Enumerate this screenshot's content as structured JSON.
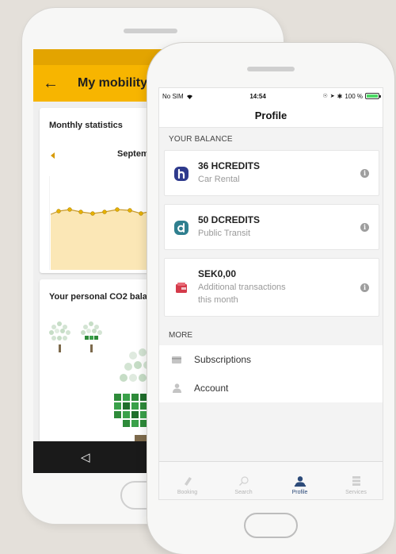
{
  "back_app": {
    "title": "My mobility",
    "back_icon": "arrow-left-icon",
    "monthly_statistics": {
      "title": "Monthly statistics",
      "month": "Septem"
    },
    "co2": {
      "title": "Your personal CO2 bala"
    },
    "android_nav": {
      "back_icon": "triangle-back-icon"
    },
    "colors": {
      "app_bar": "#f7b500",
      "status_bar": "#e3a400"
    }
  },
  "status_bar": {
    "carrier": "No SIM",
    "wifi_icon": "wifi-icon",
    "time": "14:54",
    "battery_text": "100 %"
  },
  "header": {
    "title": "Profile"
  },
  "balance": {
    "section_title": "YOUR BALANCE",
    "items": [
      {
        "amount": "36 HCREDITS",
        "label": "Car Rental",
        "icon": "h-logo-icon",
        "color": "#2e3a8c"
      },
      {
        "amount": "50 DCREDITS",
        "label": "Public Transit",
        "icon": "d-logo-icon",
        "color": "#2f7f8f"
      },
      {
        "amount": "SEK0,00",
        "label": "Additional transactions",
        "label2": "this month",
        "icon": "wallet-icon",
        "color": "#d43a4a"
      }
    ]
  },
  "more": {
    "section_title": "MORE",
    "items": [
      {
        "label": "Subscriptions",
        "icon": "card-icon"
      },
      {
        "label": "Account",
        "icon": "user-icon"
      }
    ]
  },
  "tabs": [
    {
      "label": "Booking",
      "icon": "ticket-icon",
      "active": false
    },
    {
      "label": "Search",
      "icon": "search-icon",
      "active": false
    },
    {
      "label": "Profile",
      "icon": "profile-icon",
      "active": true
    },
    {
      "label": "Services",
      "icon": "list-icon",
      "active": false
    }
  ],
  "accent_color": "#2c4a79"
}
